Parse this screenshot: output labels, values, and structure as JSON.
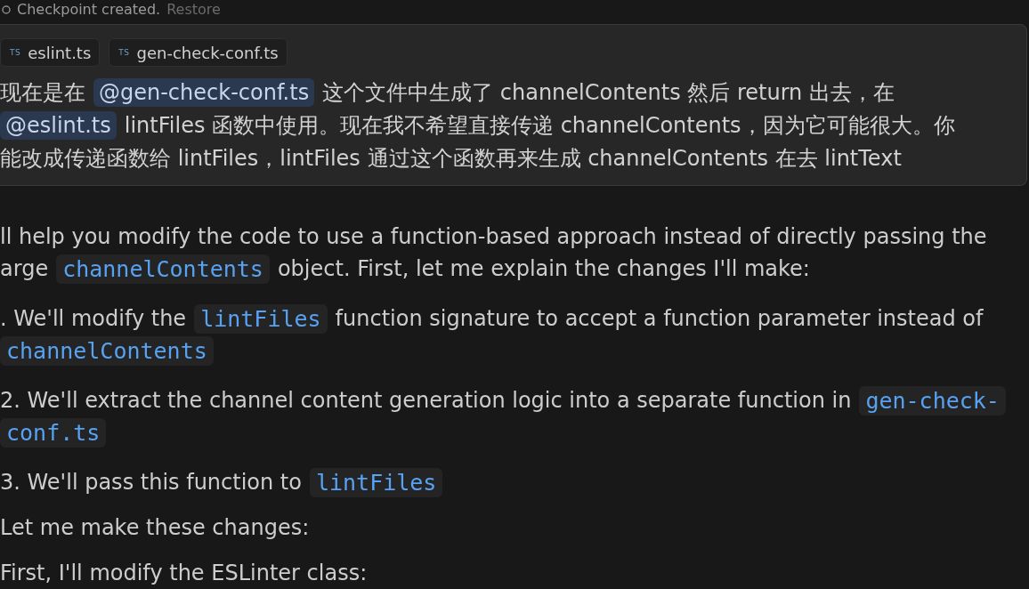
{
  "checkpoint": {
    "status": "Checkpoint created.",
    "action": "Restore"
  },
  "user_message": {
    "attachments": [
      {
        "icon": "TS",
        "name": "eslint.ts"
      },
      {
        "icon": "TS",
        "name": "gen-check-conf.ts"
      }
    ],
    "lines": [
      [
        {
          "kind": "text",
          "text": "现在是在"
        },
        {
          "kind": "mention",
          "text": "@gen-check-conf.ts"
        },
        {
          "kind": "text",
          "text": "这个文件中生成了 channelContents 然后 return 出去，在"
        }
      ],
      [
        {
          "kind": "mention",
          "text": "@eslint.ts"
        },
        {
          "kind": "text",
          "text": "lintFiles 函数中使用。现在我不希望直接传递 channelContents，因为它可能很大。你"
        }
      ],
      [
        {
          "kind": "text",
          "text": "能改成传递函数给 lintFiles，lintFiles 通过这个函数再来生成 channelContents 在去 lintText"
        }
      ]
    ]
  },
  "response": {
    "blocks": [
      {
        "kind": "paragraph",
        "lines": [
          [
            {
              "kind": "text",
              "text": "ll help you modify the code to use a function-based approach instead of directly passing the"
            }
          ],
          [
            {
              "kind": "text",
              "text": "arge"
            },
            {
              "kind": "code",
              "text": "channelContents"
            },
            {
              "kind": "text",
              "text": "object. First, let me explain the changes I'll make:"
            }
          ]
        ]
      },
      {
        "kind": "list_item",
        "lines": [
          [
            {
              "kind": "text",
              "text": ". We'll modify the"
            },
            {
              "kind": "code",
              "text": "lintFiles"
            },
            {
              "kind": "text",
              "text": "function signature to accept a function parameter instead of"
            }
          ],
          [
            {
              "kind": "code",
              "text": "channelContents"
            }
          ]
        ]
      },
      {
        "kind": "list_item",
        "lines": [
          [
            {
              "kind": "text",
              "text": "2. We'll extract the channel content generation logic into a separate function in"
            },
            {
              "kind": "code",
              "text": "gen-check-"
            }
          ],
          [
            {
              "kind": "code",
              "text": "conf.ts"
            }
          ]
        ]
      },
      {
        "kind": "list_item",
        "lines": [
          [
            {
              "kind": "text",
              "text": "3. We'll pass this function to"
            },
            {
              "kind": "code",
              "text": "lintFiles"
            }
          ]
        ]
      },
      {
        "kind": "paragraph",
        "lines": [
          [
            {
              "kind": "text",
              "text": "Let me make these changes:"
            }
          ]
        ]
      },
      {
        "kind": "paragraph",
        "lines": [
          [
            {
              "kind": "text",
              "text": "First, I'll modify the ESLinter class:"
            }
          ]
        ]
      }
    ]
  }
}
